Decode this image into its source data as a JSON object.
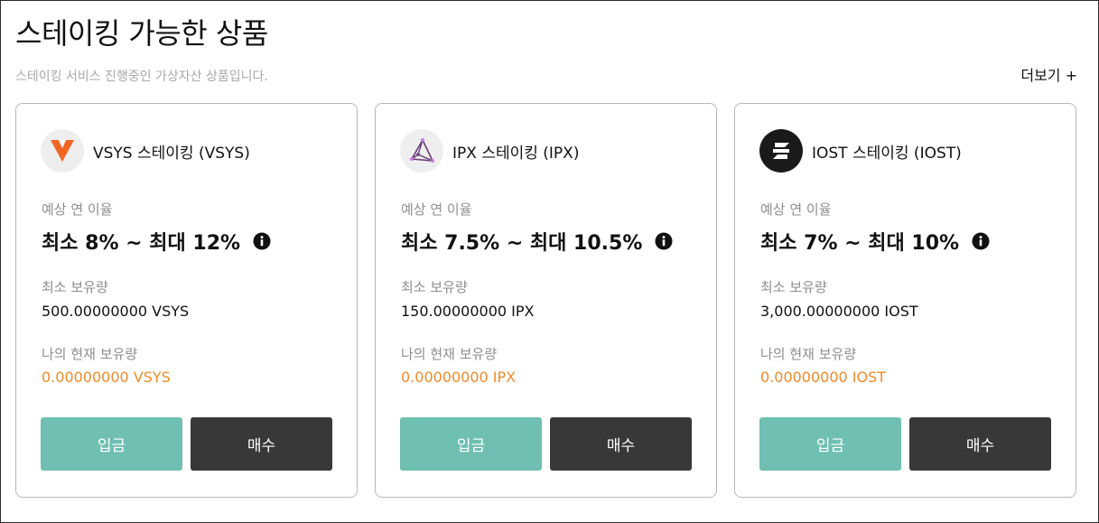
{
  "header": {
    "title": "스테이킹 가능한 상품",
    "subtitle": "스테이킹 서비스 진행중인 가상자산 상품입니다.",
    "more_label": "더보기 +"
  },
  "labels": {
    "expected_rate": "예상 연 이율",
    "min_holding": "최소 보유량",
    "my_holding": "나의 현재 보유량",
    "deposit": "입금",
    "buy": "매수"
  },
  "colors": {
    "deposit_button": "#6fbfb2",
    "buy_button": "#383838",
    "holding_value": "#f08a28"
  },
  "cards": [
    {
      "name": "VSYS 스테이킹 (VSYS)",
      "logo_icon": "vsys-logo-icon",
      "rate": "최소 8% ~ 최대 12%",
      "min_holding": "500.00000000 VSYS",
      "my_holding": "0.00000000 VSYS"
    },
    {
      "name": "IPX 스테이킹 (IPX)",
      "logo_icon": "ipx-logo-icon",
      "rate": "최소 7.5% ~ 최대 10.5%",
      "min_holding": "150.00000000 IPX",
      "my_holding": "0.00000000 IPX"
    },
    {
      "name": "IOST 스테이킹 (IOST)",
      "logo_icon": "iost-logo-icon",
      "rate": "최소 7% ~ 최대 10%",
      "min_holding": "3,000.00000000 IOST",
      "my_holding": "0.00000000 IOST"
    }
  ]
}
